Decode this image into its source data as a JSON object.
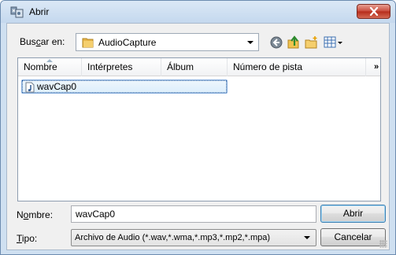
{
  "window": {
    "title": "Abrir"
  },
  "lookin": {
    "label_pre": "Bus",
    "label_ul": "c",
    "label_post": "ar en:",
    "value": "AudioCapture"
  },
  "columns": {
    "name": "Nombre",
    "artist": "Intérpretes",
    "album": "Álbum",
    "track": "Número de pista",
    "more": "»"
  },
  "files": [
    {
      "name": "wavCap0"
    }
  ],
  "filename": {
    "label_pre": "N",
    "label_ul": "o",
    "label_post": "mbre:",
    "value": "wavCap0"
  },
  "filetype": {
    "label_ul": "T",
    "label_post": "ipo:",
    "value": "Archivo de Audio (*.wav,*.wma,*.mp3,*.mp2,*.mpa)"
  },
  "buttons": {
    "open": "Abrir",
    "cancel": "Cancelar"
  },
  "colors": {
    "title_bg": "#c4d8ee",
    "close_red": "#c8493a",
    "selection": "#dceefb"
  }
}
